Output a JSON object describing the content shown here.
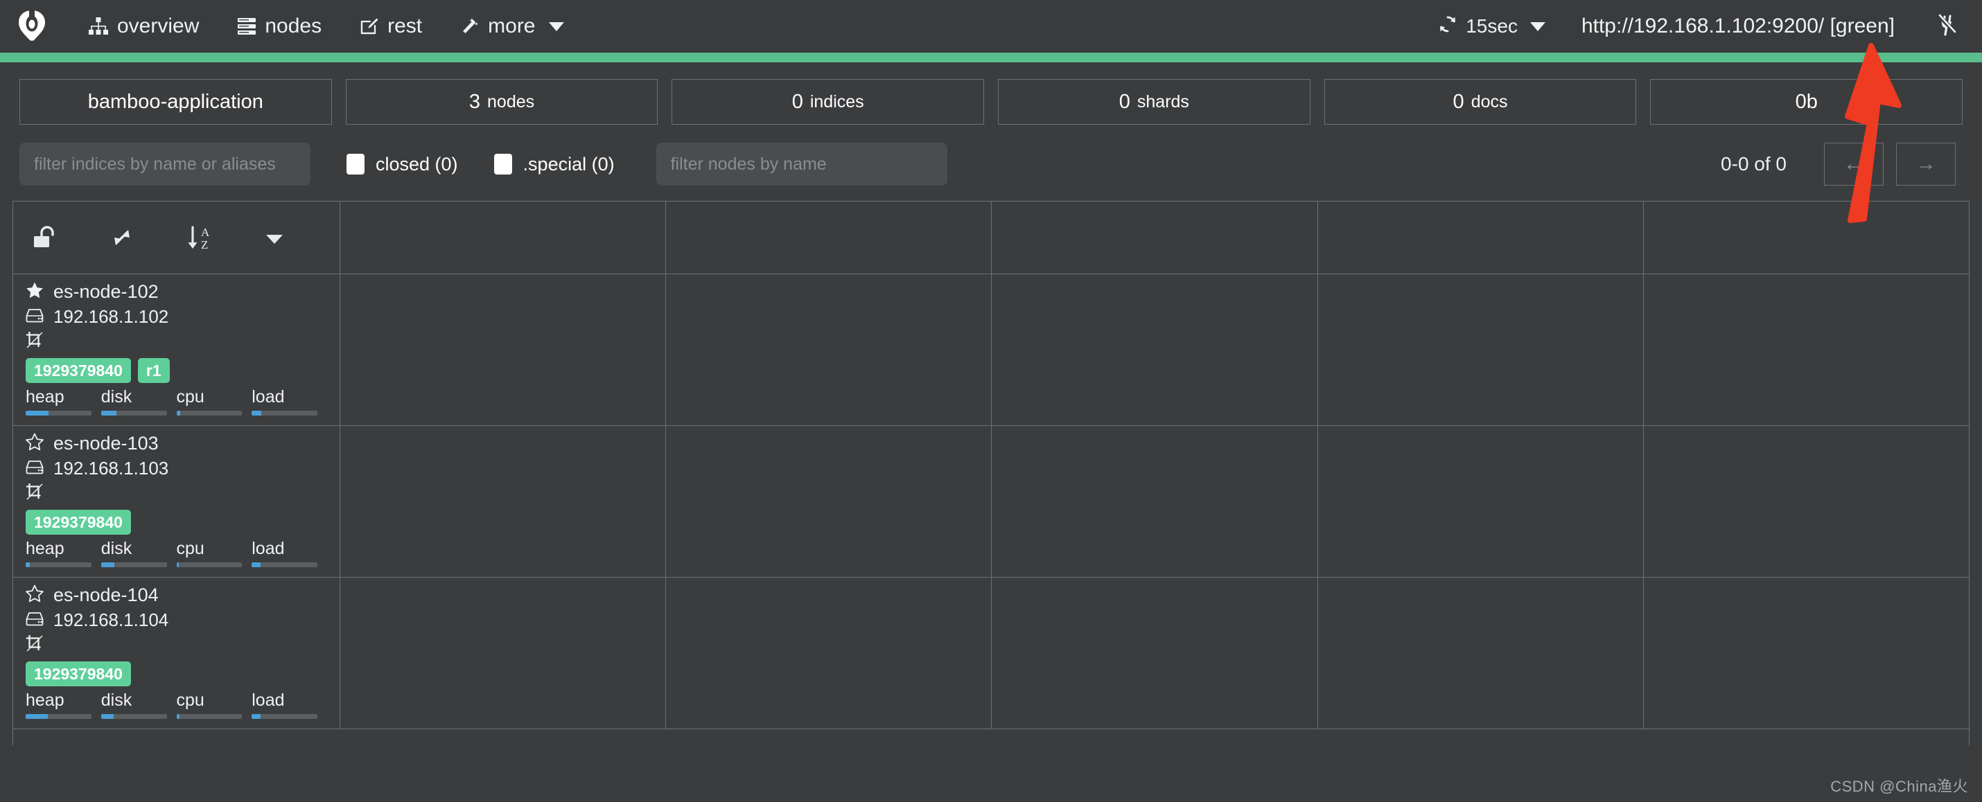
{
  "navbar": {
    "brand_icon": "cerebro-logo-icon",
    "items": [
      {
        "label": "overview",
        "icon": "sitemap-icon"
      },
      {
        "label": "nodes",
        "icon": "server-icon"
      },
      {
        "label": "rest",
        "icon": "edit-square-icon"
      },
      {
        "label": "more",
        "icon": "magic-wand-icon",
        "has_caret": true
      }
    ],
    "refresh": {
      "label": "15sec",
      "icon": "refresh-icon"
    },
    "cluster_url": "http://192.168.1.102:9200/ [green]",
    "disconnect_icon": "plug-icon",
    "status_color": "#59bd8c"
  },
  "stats": [
    {
      "value": "bamboo-application",
      "unit": "",
      "name": "cluster-name"
    },
    {
      "value": "3",
      "unit": "nodes",
      "name": "nodes-count"
    },
    {
      "value": "0",
      "unit": "indices",
      "name": "indices-count"
    },
    {
      "value": "0",
      "unit": "shards",
      "name": "shards-count"
    },
    {
      "value": "0",
      "unit": "docs",
      "name": "docs-count"
    },
    {
      "value": "0b",
      "unit": "",
      "name": "store-size"
    }
  ],
  "filters": {
    "indices_placeholder": "filter indices by name or aliases",
    "indices_value": "",
    "closed_label": "closed (0)",
    "closed_checked": false,
    "special_label": ".special (0)",
    "special_checked": false,
    "nodes_placeholder": "filter nodes by name",
    "nodes_value": ""
  },
  "pagination": {
    "label": "0-0 of 0",
    "prev": "←",
    "next": "→"
  },
  "table": {
    "toolbar_icons": [
      "unlock-icon",
      "expand-arrows-icon",
      "sort-alpha-down-icon",
      "caret-down-icon"
    ],
    "nodes": [
      {
        "name": "es-node-102",
        "ip": "192.168.1.102",
        "master": true,
        "star_icon": "star-filled-icon",
        "host_icon": "hdd-icon",
        "role_icon": "crop-slash-icon",
        "badges": [
          "1929379840",
          "r1"
        ],
        "metrics": [
          {
            "label": "heap",
            "pct": 35
          },
          {
            "label": "disk",
            "pct": 24
          },
          {
            "label": "cpu",
            "pct": 6
          },
          {
            "label": "load",
            "pct": 14
          }
        ]
      },
      {
        "name": "es-node-103",
        "ip": "192.168.1.103",
        "master": false,
        "star_icon": "star-outline-icon",
        "host_icon": "hdd-icon",
        "role_icon": "crop-slash-icon",
        "badges": [
          "1929379840"
        ],
        "metrics": [
          {
            "label": "heap",
            "pct": 6
          },
          {
            "label": "disk",
            "pct": 20
          },
          {
            "label": "cpu",
            "pct": 4
          },
          {
            "label": "load",
            "pct": 13
          }
        ]
      },
      {
        "name": "es-node-104",
        "ip": "192.168.1.104",
        "master": false,
        "star_icon": "star-outline-icon",
        "host_icon": "hdd-icon",
        "role_icon": "crop-slash-icon",
        "badges": [
          "1929379840"
        ],
        "metrics": [
          {
            "label": "heap",
            "pct": 34
          },
          {
            "label": "disk",
            "pct": 19
          },
          {
            "label": "cpu",
            "pct": 5
          },
          {
            "label": "load",
            "pct": 13
          }
        ]
      }
    ]
  },
  "annotation": {
    "arrow_color": "#ee3b21",
    "points_to": "cluster-url"
  },
  "watermark": "CSDN @China渔火"
}
